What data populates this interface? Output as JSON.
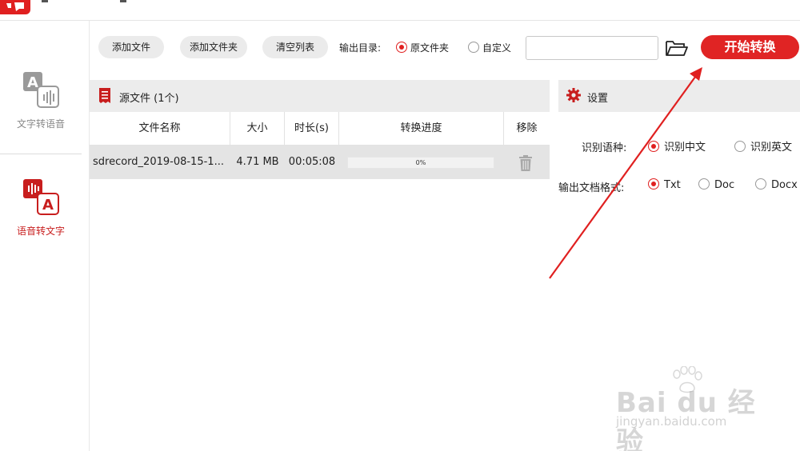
{
  "sidebar": {
    "items": [
      {
        "label": "文字转语音",
        "icon": "text-to-speech-icon",
        "active": false
      },
      {
        "label": "语音转文字",
        "icon": "speech-to-text-icon",
        "active": true
      }
    ]
  },
  "toolbar": {
    "add_file_label": "添加文件",
    "add_folder_label": "添加文件夹",
    "clear_list_label": "清空列表",
    "output_dir_label": "输出目录:",
    "output_options": [
      {
        "label": "原文件夹",
        "selected": true
      },
      {
        "label": "自定义",
        "selected": false
      }
    ],
    "path_value": "",
    "folder_icon": "folder-open-icon",
    "start_label": "开始转换"
  },
  "source": {
    "title": "源文件 (1个)",
    "columns": [
      "文件名称",
      "大小",
      "时长(s)",
      "转换进度",
      "移除"
    ],
    "rows": [
      {
        "name": "sdrecord_2019-08-15-1...",
        "size": "4.71 MB",
        "duration": "00:05:08",
        "progress_text": "0%",
        "progress": 0
      }
    ]
  },
  "settings": {
    "title": "设置",
    "language_label": "识别语种:",
    "language_options": [
      {
        "label": "识别中文",
        "selected": true
      },
      {
        "label": "识别英文",
        "selected": false
      }
    ],
    "format_label": "输出文档格式:",
    "format_options": [
      {
        "label": "Txt",
        "selected": true
      },
      {
        "label": "Doc",
        "selected": false
      },
      {
        "label": "Docx",
        "selected": false
      }
    ]
  },
  "watermark": {
    "brand": "Bai du 经验",
    "site": "jingyan.baidu.com"
  },
  "colors": {
    "accent": "#e02020",
    "header_bg": "#ececec",
    "row_bg": "#e4e4e4"
  }
}
